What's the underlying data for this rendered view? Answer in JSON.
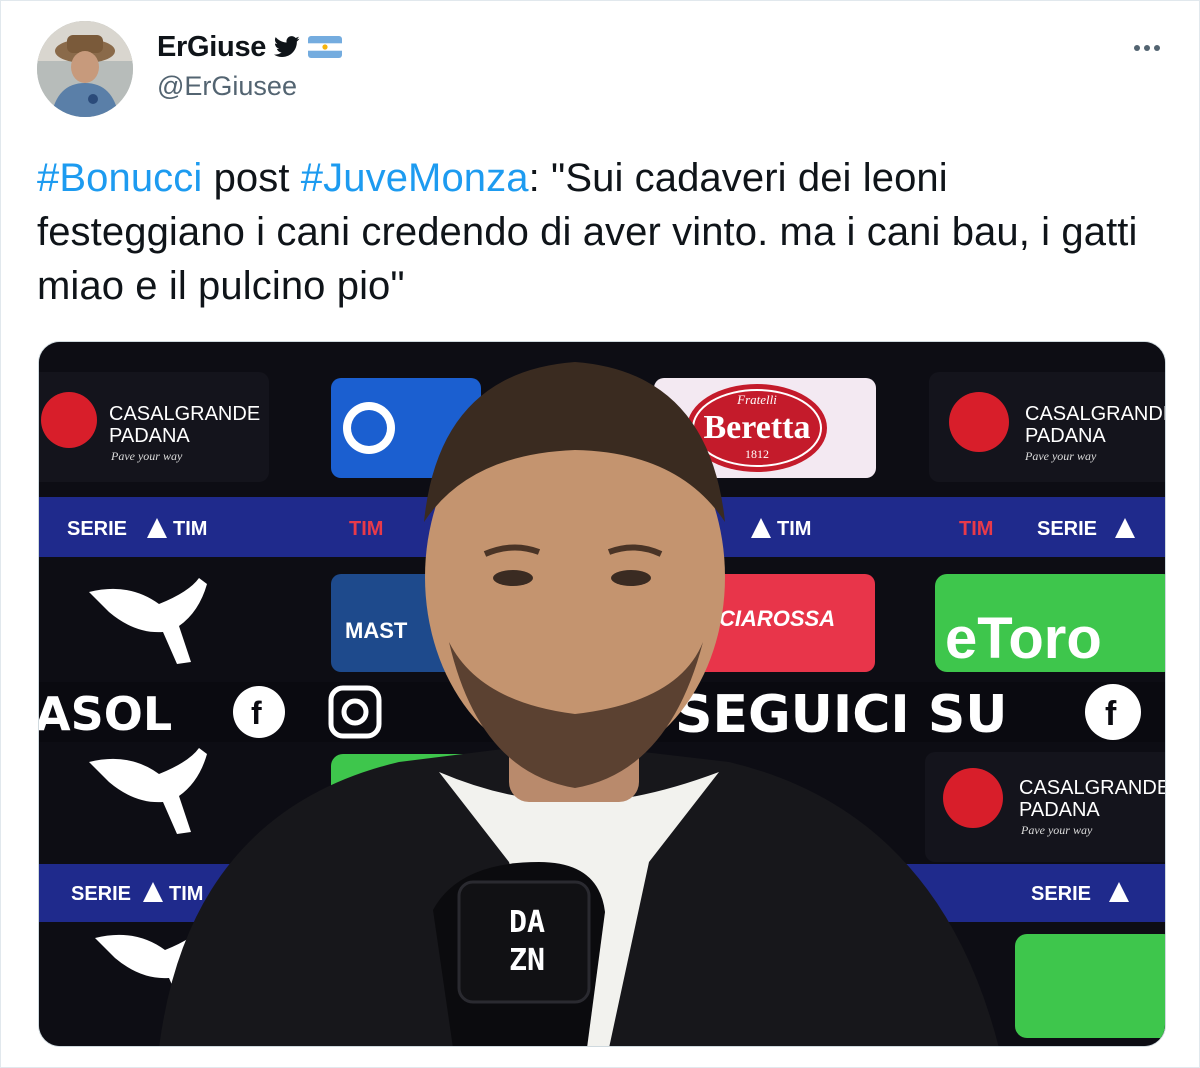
{
  "author": {
    "display_name": "ErGiuse",
    "handle": "@ErGiusee",
    "verified_icon": "twitter-bird-icon",
    "flag_icon": "argentina-flag-icon"
  },
  "menu": {
    "icon": "more-horizontal-icon"
  },
  "tweet": {
    "hashtag_1": "#Bonucci",
    "text_1": " post ",
    "hashtag_2": "#JuveMonza",
    "text_2": ": \"Sui cadaveri dei leoni festeggiano i cani credendo di aver vinto. ma i cani bau, i gatti miao e il pulcino pio\""
  },
  "colors": {
    "hashtag": "#1d9bf0",
    "handle": "#536471",
    "text": "#0f1419",
    "serie_a_band": "#1f2a8c",
    "etoro_green": "#3ec64c",
    "casalgrande_red": "#d81e2a"
  },
  "media": {
    "sponsor_casalgrande_1": "CASALGRANDE",
    "sponsor_casalgrande_2": "PADANA",
    "sponsor_casalgrande_tag": "Pave your way",
    "sponsor_beretta_top": "Fratelli",
    "sponsor_beretta": "Beretta",
    "sponsor_beretta_year": "1812",
    "band_serie": "SERIE",
    "band_tim": "TIM",
    "sponsor_ciarossa": "CIAROSSA",
    "sponsor_etoro": "eToro",
    "sponsor_master": "MAST",
    "social_left": "ASOL",
    "social_follow": "SEGUICI SU",
    "mic_brand_top": "DA",
    "mic_brand_bottom": "ZN"
  }
}
